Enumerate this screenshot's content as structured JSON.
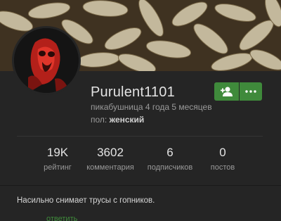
{
  "profile": {
    "username": "Purulent1101",
    "member_since": "пикабушница 4 года 5 месяцев",
    "gender_label": "пол:",
    "gender_value": "женский",
    "about": "Насильно снимает трусы с гопников."
  },
  "actions": {
    "follow_icon": "add-user-icon",
    "more_icon": "more-dots-icon",
    "accent": "#3f8a3b"
  },
  "stats": [
    {
      "value": "19K",
      "label": "рейтинг"
    },
    {
      "value": "3602",
      "label": "комментария"
    },
    {
      "value": "6",
      "label": "подписчиков"
    },
    {
      "value": "0",
      "label": "постов"
    }
  ],
  "bottom_link": "ответить"
}
